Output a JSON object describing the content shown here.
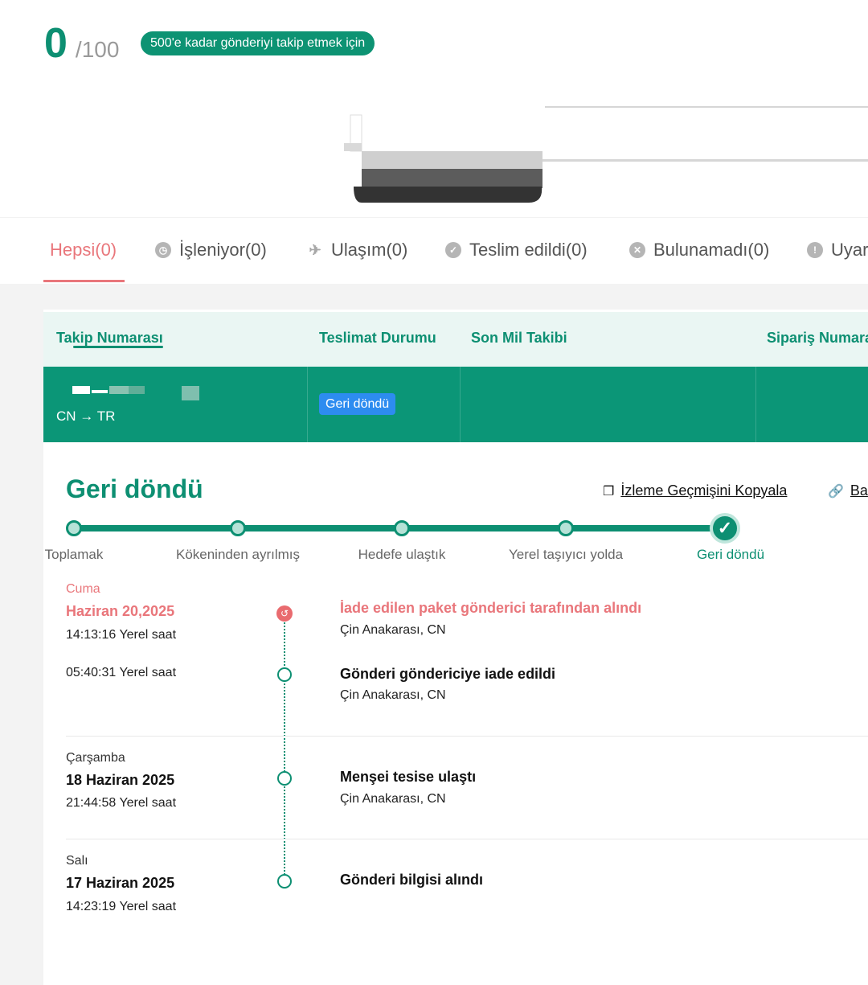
{
  "quota": {
    "count": "0",
    "max": "/100",
    "badge": "500'e kadar gönderiyi takip etmek için"
  },
  "tabs": [
    {
      "label": "Hepsi(0)",
      "icon": "none",
      "active": true
    },
    {
      "label": "İşleniyor(0)",
      "icon": "clock-icon"
    },
    {
      "label": "Ulaşım(0)",
      "icon": "plane-icon"
    },
    {
      "label": "Teslim edildi(0)",
      "icon": "check-circle-icon"
    },
    {
      "label": "Bulunamadı(0)",
      "icon": "x-circle-icon"
    },
    {
      "label": "Uyar",
      "icon": "warning-icon"
    }
  ],
  "table": {
    "headers": [
      "Takip Numarası",
      "Teslimat Durumu",
      "Son Mil Takibi",
      "Sipariş Numara"
    ],
    "row": {
      "route": "CN → TR",
      "status": "Geri döndü"
    }
  },
  "detail": {
    "title": "Geri döndü",
    "copy_label": "İzleme Geçmişini Kopyala",
    "link_label": "Ba"
  },
  "steps": [
    "Toplamak",
    "Kökeninden ayrılmış",
    "Hedefe ulaştık",
    "Yerel taşıyıcı yolda",
    "Geri döndü"
  ],
  "events": [
    {
      "day": "Cuma",
      "date": "Haziran 20,2025",
      "time": "14:13:16 Yerel saat",
      "title": "İade edilen paket gönderici tarafından alındı",
      "location": "Çin Anakarası, CN"
    },
    {
      "time": "05:40:31 Yerel saat",
      "title": "Gönderi göndericiye iade edildi",
      "location": "Çin Anakarası, CN"
    },
    {
      "day": "Çarşamba",
      "date": "18 Haziran 2025",
      "time": "21:44:58 Yerel saat",
      "title": "Menşei tesise ulaştı",
      "location": "Çin Anakarası, CN"
    },
    {
      "day": "Salı",
      "date": "17 Haziran 2025",
      "time": "14:23:19 Yerel saat",
      "title": "Gönderi bilgisi alındı"
    }
  ],
  "colors": {
    "brand": "#0d8f72",
    "alert": "#e9767b",
    "chip": "#2d8cf0"
  }
}
